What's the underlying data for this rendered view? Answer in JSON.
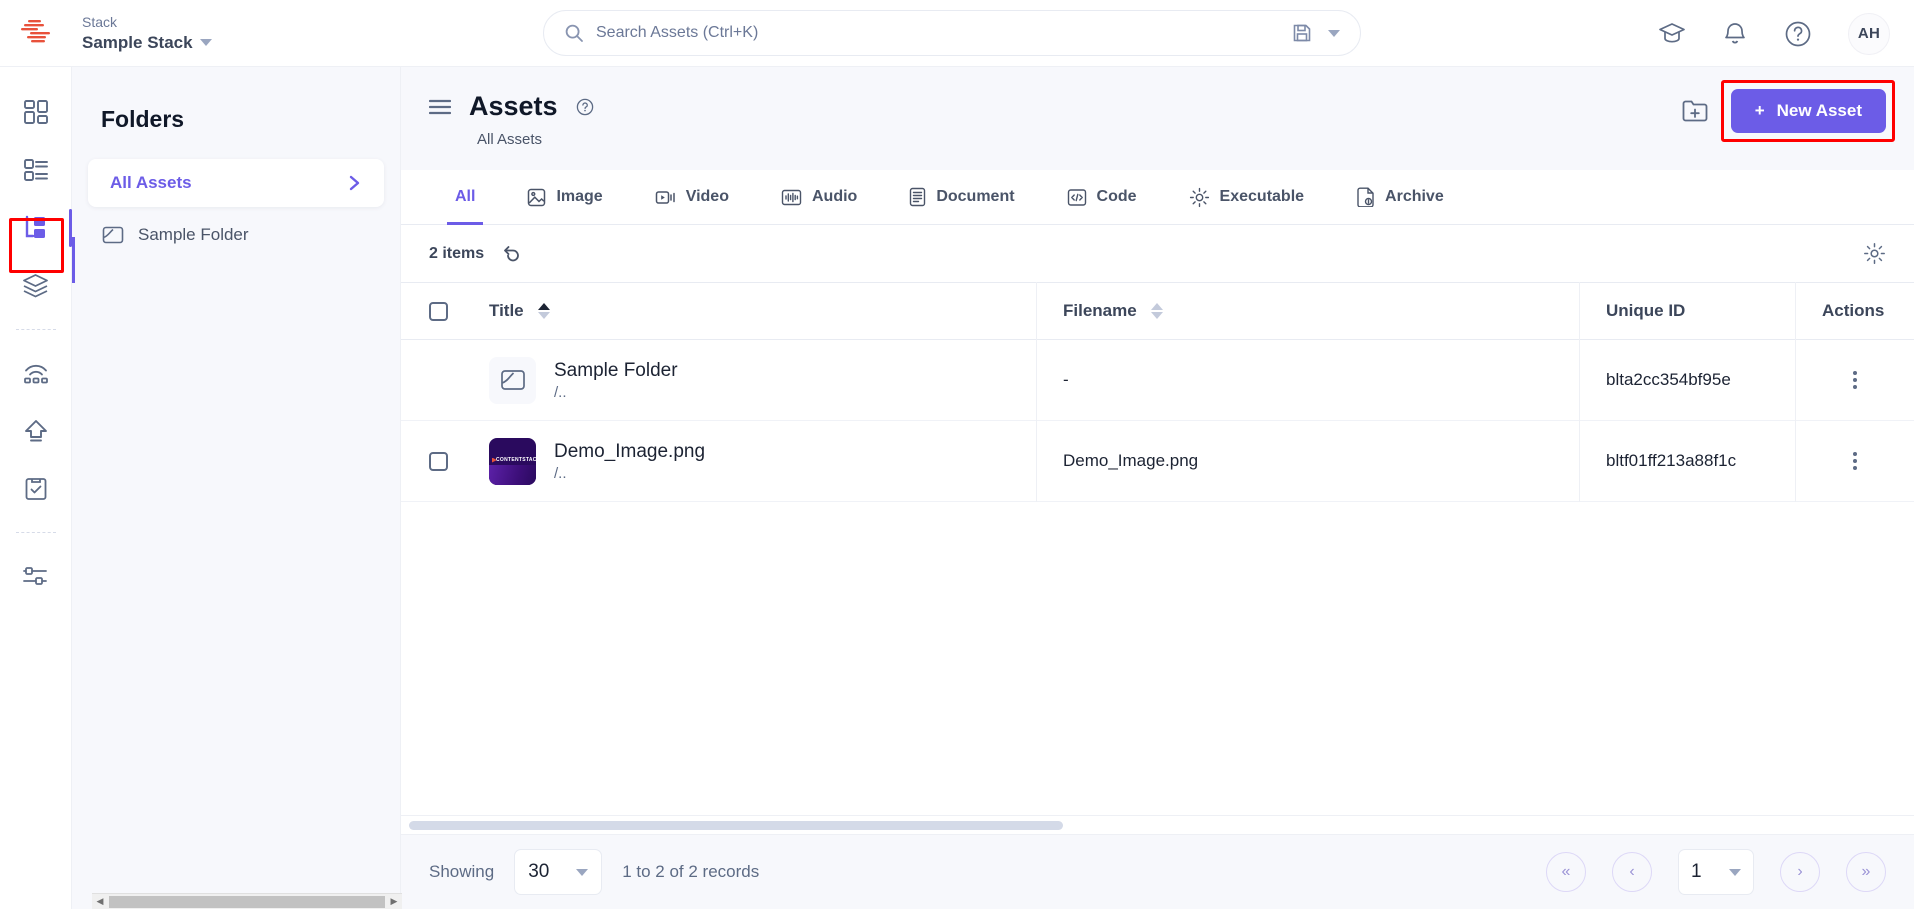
{
  "topbar": {
    "stack_label": "Stack",
    "stack_name": "Sample Stack",
    "search_placeholder": "Search Assets (Ctrl+K)",
    "search_value": "",
    "save_icon": "save-icon",
    "dropdown_icon": "chevron-down-icon",
    "icons": [
      {
        "name": "academy-icon",
        "glyph": "graduation-cap"
      },
      {
        "name": "notifications-icon",
        "glyph": "bell"
      },
      {
        "name": "help-icon",
        "glyph": "question-circle"
      }
    ],
    "avatar_initials": "AH"
  },
  "rail": {
    "items": [
      {
        "name": "sidebar-item-dashboard",
        "icon": "dashboard-grid-icon",
        "active": false
      },
      {
        "name": "sidebar-item-entries",
        "icon": "content-list-icon",
        "active": false
      },
      {
        "name": "sidebar-item-assets",
        "icon": "assets-icon",
        "active": true
      },
      {
        "name": "sidebar-item-stacks",
        "icon": "layers-icon",
        "active": false
      },
      {
        "name": "sidebar-item-live-preview",
        "icon": "broadcast-icon",
        "active": false
      },
      {
        "name": "sidebar-item-publish",
        "icon": "upload-arrow-icon",
        "active": false
      },
      {
        "name": "sidebar-item-tasks",
        "icon": "clipboard-check-icon",
        "active": false
      },
      {
        "name": "sidebar-item-settings",
        "icon": "sliders-icon",
        "active": false
      }
    ]
  },
  "folders": {
    "title": "Folders",
    "all_assets_label": "All Assets",
    "chevron_icon": "chevron-right-icon",
    "items": [
      {
        "label": "Sample Folder",
        "icon": "folder-icon"
      }
    ]
  },
  "main": {
    "menu_icon": "hamburger-menu-icon",
    "page_title": "Assets",
    "help_icon": "help-circle-icon",
    "breadcrumb": "All Assets",
    "new_folder_icon": "new-folder-icon",
    "new_asset_label": "New Asset",
    "new_asset_plus": "+",
    "accent_color": "#6c5ce7",
    "highlight_color": "#ff0000",
    "tabs": [
      {
        "label": "All",
        "icon": "",
        "active": true
      },
      {
        "label": "Image",
        "icon": "image-icon",
        "active": false
      },
      {
        "label": "Video",
        "icon": "video-icon",
        "active": false
      },
      {
        "label": "Audio",
        "icon": "audio-icon",
        "active": false
      },
      {
        "label": "Document",
        "icon": "document-icon",
        "active": false
      },
      {
        "label": "Code",
        "icon": "code-icon",
        "active": false
      },
      {
        "label": "Executable",
        "icon": "gear-icon",
        "active": false
      },
      {
        "label": "Archive",
        "icon": "archive-icon",
        "active": false
      }
    ],
    "items_count": "2 items",
    "refresh_icon": "refresh-undo-icon",
    "settings_icon": "gear-icon",
    "table": {
      "columns": [
        {
          "key": "title",
          "label": "Title",
          "sortable": true,
          "sort": "asc"
        },
        {
          "key": "filename",
          "label": "Filename",
          "sortable": true,
          "sort": "none"
        },
        {
          "key": "uid",
          "label": "Unique ID",
          "sortable": false,
          "sort": "none"
        },
        {
          "key": "actions",
          "label": "Actions",
          "sortable": false,
          "sort": "none"
        }
      ],
      "rows": [
        {
          "selectable": false,
          "thumb": "folder-thumbnail",
          "title": "Sample Folder",
          "path": "/..",
          "filename": "-",
          "uid": "blta2cc354bf95e"
        },
        {
          "selectable": true,
          "thumb": "image-thumbnail-contentstack",
          "title": "Demo_Image.png",
          "path": "/..",
          "filename": "Demo_Image.png",
          "uid": "bltf01ff213a88f1c"
        }
      ]
    }
  },
  "footer": {
    "showing_label": "Showing",
    "page_size": "30",
    "records_label": "1 to 2 of 2 records",
    "current_page": "1",
    "pager": [
      {
        "name": "first-page-button",
        "glyph": "«"
      },
      {
        "name": "previous-page-button",
        "glyph": "‹"
      },
      {
        "name": "next-page-button",
        "glyph": "›"
      },
      {
        "name": "last-page-button",
        "glyph": "»"
      }
    ]
  }
}
